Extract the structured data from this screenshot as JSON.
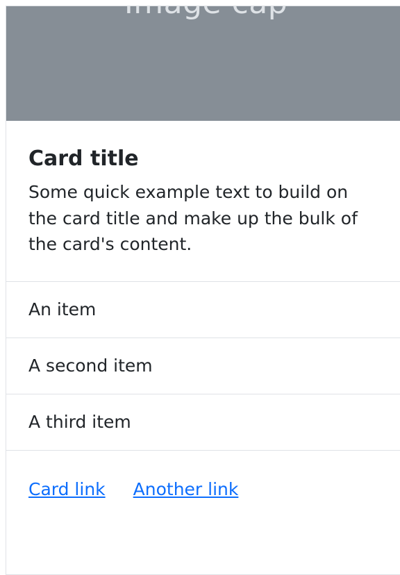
{
  "card": {
    "image_text": "Image cap",
    "title": "Card title",
    "text": "Some quick example text to build on the card title and make up the bulk of the card's content.",
    "list_items": [
      {
        "label": "An item"
      },
      {
        "label": "A second item"
      },
      {
        "label": "A third item"
      }
    ],
    "links": [
      {
        "label": "Card link"
      },
      {
        "label": "Another link"
      }
    ]
  },
  "colors": {
    "image_placeholder": "#868e96",
    "link": "#0d6efd",
    "border": "#dfe2e6",
    "text": "#212529"
  }
}
